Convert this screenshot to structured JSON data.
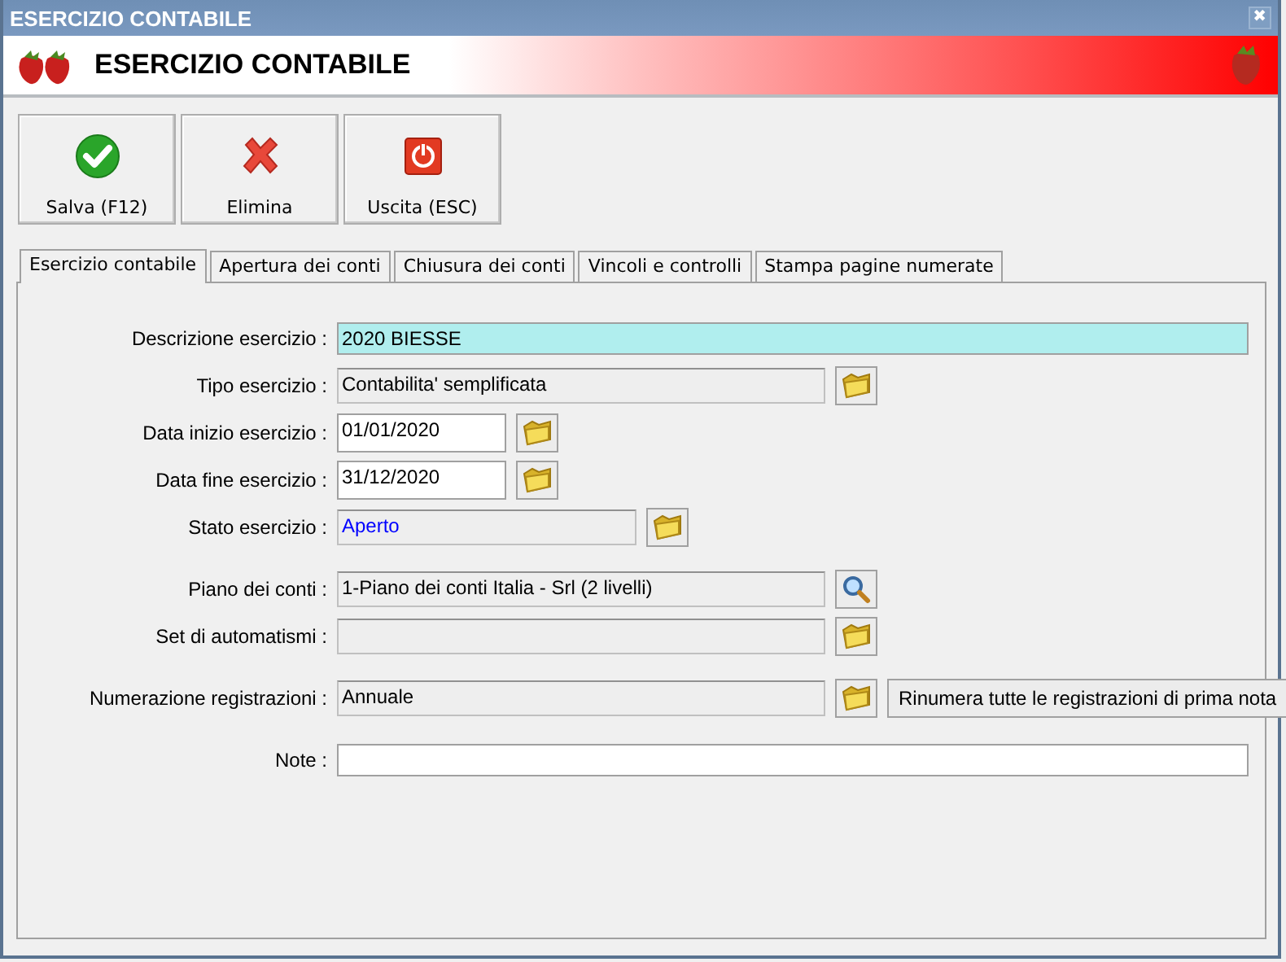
{
  "window": {
    "title": "ESERCIZIO CONTABILE",
    "close": "✖"
  },
  "header": {
    "title": "ESERCIZIO CONTABILE"
  },
  "toolbar": [
    {
      "label": "Salva (F12)",
      "kind": "save"
    },
    {
      "label": "Elimina",
      "kind": "delete"
    },
    {
      "label": "Uscita (ESC)",
      "kind": "exit"
    }
  ],
  "tabs": [
    {
      "label": "Esercizio contabile",
      "selected": true
    },
    {
      "label": "Apertura dei conti",
      "selected": false
    },
    {
      "label": "Chiusura dei conti",
      "selected": false
    },
    {
      "label": "Vincoli e controlli",
      "selected": false
    },
    {
      "label": "Stampa pagine numerate",
      "selected": false
    }
  ],
  "form": [
    [
      {
        "label": "Descrizione esercizio :",
        "value": "2020 BIESSE",
        "focused": true,
        "readonly": false,
        "kind": "plain"
      },
      {
        "label": "Tipo esercizio :",
        "value": "Contabilita' semplificata",
        "focused": false,
        "readonly": true,
        "kind": "folder"
      },
      {
        "label": "Data inizio esercizio :",
        "value": "01/01/2020",
        "focused": false,
        "readonly": false,
        "kind": "folder"
      },
      {
        "label": "Data fine esercizio :",
        "value": "31/12/2020",
        "focused": false,
        "readonly": false,
        "kind": "folder"
      },
      {
        "label": "Stato esercizio :",
        "value": "Aperto",
        "color": "#0000ff",
        "focused": false,
        "readonly": true,
        "kind": "folder"
      }
    ],
    [
      {
        "label": "Piano dei conti :",
        "value": "1-Piano dei conti Italia - Srl (2 livelli)",
        "focused": false,
        "readonly": true,
        "kind": "search"
      },
      {
        "label": "Set di automatismi :",
        "focused": false,
        "readonly": true,
        "kind": "folder"
      }
    ],
    [
      {
        "label": "Numerazione registrazioni :",
        "value": "Annuale",
        "focused": false,
        "readonly": true,
        "kind": "folder",
        "action": "Rinumera tutte le registrazioni di prima nota"
      }
    ],
    [
      {
        "label": "Note :",
        "focused": false,
        "readonly": false,
        "kind": "plain"
      }
    ]
  ]
}
